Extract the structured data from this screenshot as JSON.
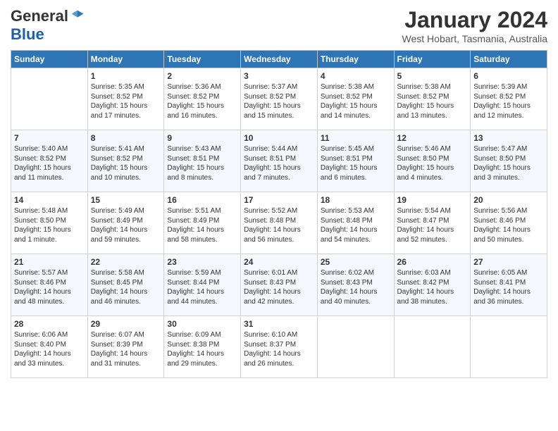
{
  "logo": {
    "general": "General",
    "blue": "Blue"
  },
  "title": "January 2024",
  "location": "West Hobart, Tasmania, Australia",
  "days_header": [
    "Sunday",
    "Monday",
    "Tuesday",
    "Wednesday",
    "Thursday",
    "Friday",
    "Saturday"
  ],
  "weeks": [
    [
      {
        "day": "",
        "content": ""
      },
      {
        "day": "1",
        "content": "Sunrise: 5:35 AM\nSunset: 8:52 PM\nDaylight: 15 hours\nand 17 minutes."
      },
      {
        "day": "2",
        "content": "Sunrise: 5:36 AM\nSunset: 8:52 PM\nDaylight: 15 hours\nand 16 minutes."
      },
      {
        "day": "3",
        "content": "Sunrise: 5:37 AM\nSunset: 8:52 PM\nDaylight: 15 hours\nand 15 minutes."
      },
      {
        "day": "4",
        "content": "Sunrise: 5:38 AM\nSunset: 8:52 PM\nDaylight: 15 hours\nand 14 minutes."
      },
      {
        "day": "5",
        "content": "Sunrise: 5:38 AM\nSunset: 8:52 PM\nDaylight: 15 hours\nand 13 minutes."
      },
      {
        "day": "6",
        "content": "Sunrise: 5:39 AM\nSunset: 8:52 PM\nDaylight: 15 hours\nand 12 minutes."
      }
    ],
    [
      {
        "day": "7",
        "content": "Sunrise: 5:40 AM\nSunset: 8:52 PM\nDaylight: 15 hours\nand 11 minutes."
      },
      {
        "day": "8",
        "content": "Sunrise: 5:41 AM\nSunset: 8:52 PM\nDaylight: 15 hours\nand 10 minutes."
      },
      {
        "day": "9",
        "content": "Sunrise: 5:43 AM\nSunset: 8:51 PM\nDaylight: 15 hours\nand 8 minutes."
      },
      {
        "day": "10",
        "content": "Sunrise: 5:44 AM\nSunset: 8:51 PM\nDaylight: 15 hours\nand 7 minutes."
      },
      {
        "day": "11",
        "content": "Sunrise: 5:45 AM\nSunset: 8:51 PM\nDaylight: 15 hours\nand 6 minutes."
      },
      {
        "day": "12",
        "content": "Sunrise: 5:46 AM\nSunset: 8:50 PM\nDaylight: 15 hours\nand 4 minutes."
      },
      {
        "day": "13",
        "content": "Sunrise: 5:47 AM\nSunset: 8:50 PM\nDaylight: 15 hours\nand 3 minutes."
      }
    ],
    [
      {
        "day": "14",
        "content": "Sunrise: 5:48 AM\nSunset: 8:50 PM\nDaylight: 15 hours\nand 1 minute."
      },
      {
        "day": "15",
        "content": "Sunrise: 5:49 AM\nSunset: 8:49 PM\nDaylight: 14 hours\nand 59 minutes."
      },
      {
        "day": "16",
        "content": "Sunrise: 5:51 AM\nSunset: 8:49 PM\nDaylight: 14 hours\nand 58 minutes."
      },
      {
        "day": "17",
        "content": "Sunrise: 5:52 AM\nSunset: 8:48 PM\nDaylight: 14 hours\nand 56 minutes."
      },
      {
        "day": "18",
        "content": "Sunrise: 5:53 AM\nSunset: 8:48 PM\nDaylight: 14 hours\nand 54 minutes."
      },
      {
        "day": "19",
        "content": "Sunrise: 5:54 AM\nSunset: 8:47 PM\nDaylight: 14 hours\nand 52 minutes."
      },
      {
        "day": "20",
        "content": "Sunrise: 5:56 AM\nSunset: 8:46 PM\nDaylight: 14 hours\nand 50 minutes."
      }
    ],
    [
      {
        "day": "21",
        "content": "Sunrise: 5:57 AM\nSunset: 8:46 PM\nDaylight: 14 hours\nand 48 minutes."
      },
      {
        "day": "22",
        "content": "Sunrise: 5:58 AM\nSunset: 8:45 PM\nDaylight: 14 hours\nand 46 minutes."
      },
      {
        "day": "23",
        "content": "Sunrise: 5:59 AM\nSunset: 8:44 PM\nDaylight: 14 hours\nand 44 minutes."
      },
      {
        "day": "24",
        "content": "Sunrise: 6:01 AM\nSunset: 8:43 PM\nDaylight: 14 hours\nand 42 minutes."
      },
      {
        "day": "25",
        "content": "Sunrise: 6:02 AM\nSunset: 8:43 PM\nDaylight: 14 hours\nand 40 minutes."
      },
      {
        "day": "26",
        "content": "Sunrise: 6:03 AM\nSunset: 8:42 PM\nDaylight: 14 hours\nand 38 minutes."
      },
      {
        "day": "27",
        "content": "Sunrise: 6:05 AM\nSunset: 8:41 PM\nDaylight: 14 hours\nand 36 minutes."
      }
    ],
    [
      {
        "day": "28",
        "content": "Sunrise: 6:06 AM\nSunset: 8:40 PM\nDaylight: 14 hours\nand 33 minutes."
      },
      {
        "day": "29",
        "content": "Sunrise: 6:07 AM\nSunset: 8:39 PM\nDaylight: 14 hours\nand 31 minutes."
      },
      {
        "day": "30",
        "content": "Sunrise: 6:09 AM\nSunset: 8:38 PM\nDaylight: 14 hours\nand 29 minutes."
      },
      {
        "day": "31",
        "content": "Sunrise: 6:10 AM\nSunset: 8:37 PM\nDaylight: 14 hours\nand 26 minutes."
      },
      {
        "day": "",
        "content": ""
      },
      {
        "day": "",
        "content": ""
      },
      {
        "day": "",
        "content": ""
      }
    ]
  ]
}
